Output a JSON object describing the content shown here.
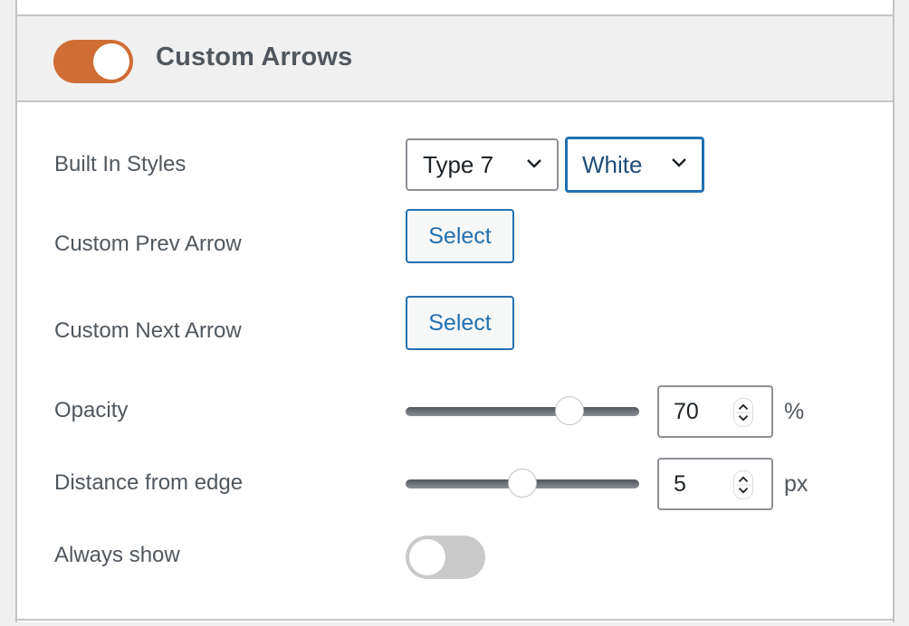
{
  "section": {
    "title": "Custom Arrows",
    "enabled": true,
    "toggle_color": "#d06d34"
  },
  "fields": {
    "built_in_styles": {
      "label": "Built In Styles",
      "type_select": "Type 7",
      "color_select": "White"
    },
    "custom_prev_arrow": {
      "label": "Custom Prev Arrow",
      "button": "Select"
    },
    "custom_next_arrow": {
      "label": "Custom Next Arrow",
      "button": "Select"
    },
    "opacity": {
      "label": "Opacity",
      "value": "70",
      "unit": "%",
      "slider_fraction": 0.7
    },
    "distance": {
      "label": "Distance from edge",
      "value": "5",
      "unit": "px",
      "slider_fraction": 0.5
    },
    "always_show": {
      "label": "Always show",
      "enabled": false
    }
  },
  "colors": {
    "accent": "#2271b1",
    "toggle_off": "#c9c9c9"
  }
}
